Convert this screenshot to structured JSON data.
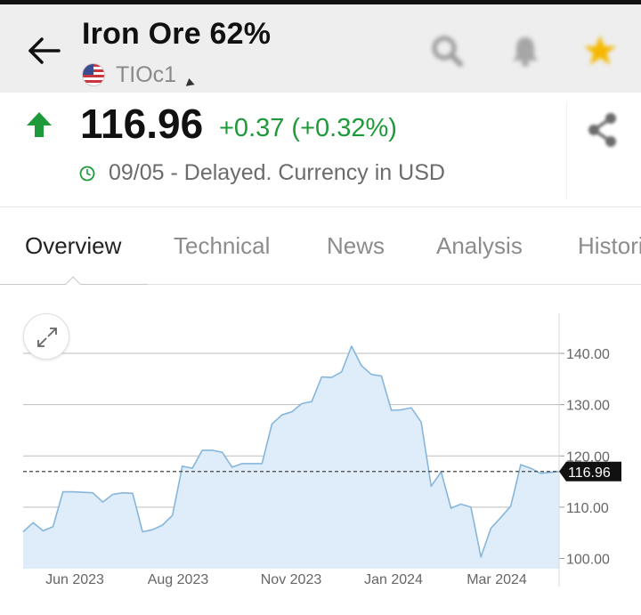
{
  "header": {
    "title": "Iron Ore 62%",
    "ticker": "TIOc1",
    "flag": "us-flag",
    "icons": [
      "back-arrow-icon",
      "search-icon",
      "alert-bell-icon",
      "watchlist-star-icon"
    ]
  },
  "quote": {
    "price": "116.96",
    "change": "+0.37 (+0.32%)",
    "direction": "up",
    "time_text": "09/05 - Delayed. Currency in USD",
    "accent": "#1e9a3a"
  },
  "tabs": [
    {
      "label": "Overview",
      "active": true
    },
    {
      "label": "Technical",
      "active": false
    },
    {
      "label": "News",
      "active": false
    },
    {
      "label": "Analysis",
      "active": false
    },
    {
      "label": "Historical Data",
      "active": false
    }
  ],
  "chart_data": {
    "type": "area",
    "x_ticks": [
      "Jun 2023",
      "Aug 2023",
      "Nov 2023",
      "Jan 2024",
      "Mar 2024"
    ],
    "y_ticks": [
      "140.00",
      "130.00",
      "120.00",
      "110.00",
      "100.00"
    ],
    "ylim": [
      98,
      144
    ],
    "current_value": 116.96,
    "current_label": "116.96",
    "grid": true,
    "line_color": "#86b6dc",
    "fill_color": "#deedf9",
    "dates": [
      "2023-04-28",
      "2023-05-05",
      "2023-05-12",
      "2023-05-19",
      "2023-05-26",
      "2023-06-02",
      "2023-06-16",
      "2023-06-23",
      "2023-06-30",
      "2023-07-07",
      "2023-07-14",
      "2023-07-21",
      "2023-07-28",
      "2023-08-04",
      "2023-08-11",
      "2023-08-18",
      "2023-08-25",
      "2023-09-01",
      "2023-09-08",
      "2023-09-15",
      "2023-09-22",
      "2023-09-29",
      "2023-10-06",
      "2023-10-13",
      "2023-10-20",
      "2023-10-27",
      "2023-11-03",
      "2023-11-10",
      "2023-11-17",
      "2023-11-24",
      "2023-12-01",
      "2023-12-08",
      "2023-12-15",
      "2023-12-22",
      "2023-12-29",
      "2024-01-05",
      "2024-01-12",
      "2024-01-19",
      "2024-01-26",
      "2024-02-02",
      "2024-02-09",
      "2024-02-16",
      "2024-02-23",
      "2024-03-01",
      "2024-03-08",
      "2024-03-15",
      "2024-03-22",
      "2024-03-29",
      "2024-04-05",
      "2024-04-12",
      "2024-04-19",
      "2024-04-26",
      "2024-05-03",
      "2024-05-09"
    ],
    "values": [
      105.2,
      107.0,
      105.4,
      106.2,
      113.0,
      113.0,
      112.8,
      111.0,
      112.5,
      112.8,
      112.7,
      105.2,
      105.6,
      106.5,
      108.4,
      118.0,
      117.6,
      121.1,
      121.1,
      120.7,
      117.8,
      118.5,
      118.5,
      118.5,
      126.2,
      128.0,
      128.6,
      130.2,
      130.6,
      135.4,
      135.3,
      136.4,
      141.4,
      137.6,
      135.9,
      135.6,
      128.9,
      129.0,
      129.4,
      126.6,
      114.1,
      116.9,
      109.8,
      110.6,
      110.0,
      100.3,
      105.9,
      108.0,
      110.2,
      118.3,
      117.6,
      116.6,
      116.8,
      116.96
    ]
  }
}
